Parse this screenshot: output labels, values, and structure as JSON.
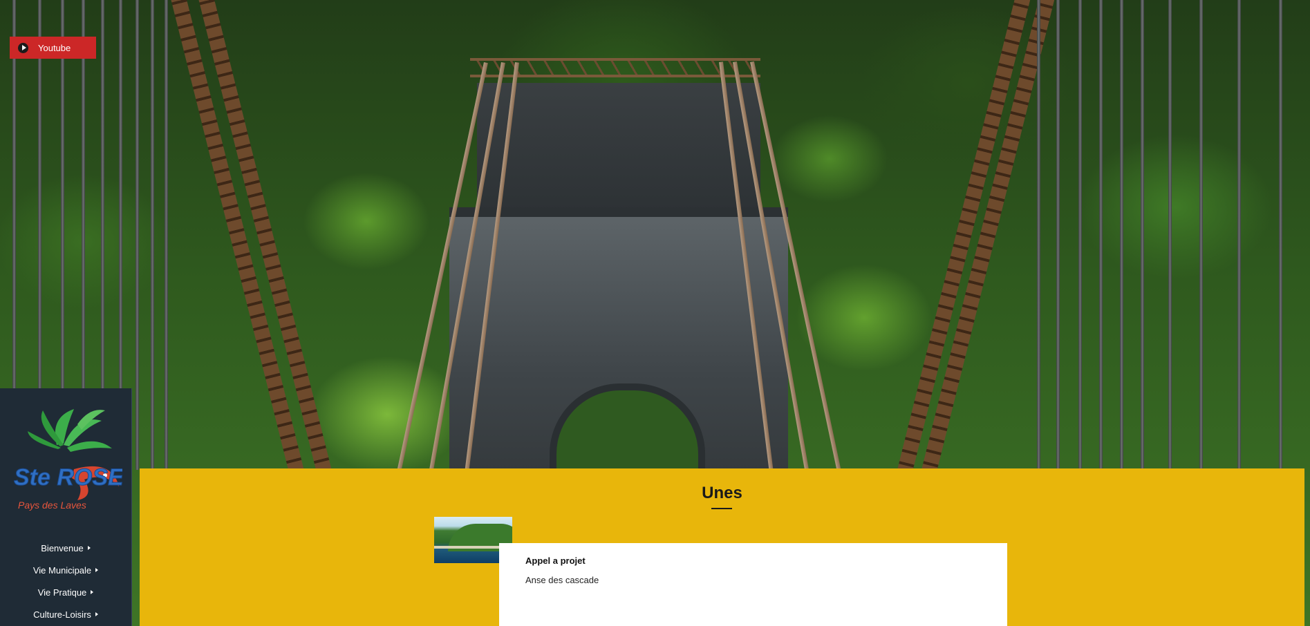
{
  "social": {
    "youtube_label": "Youtube"
  },
  "logo": {
    "wordmark": "Ste ROSE",
    "tagline": "Pays des Laves"
  },
  "nav": {
    "items": [
      {
        "label": "Bienvenue"
      },
      {
        "label": "Vie Municipale"
      },
      {
        "label": "Vie Pratique"
      },
      {
        "label": "Culture-Loisirs"
      }
    ]
  },
  "unes": {
    "title": "Unes",
    "card": {
      "title": "Appel a projet",
      "subtitle": "Anse des cascade"
    }
  },
  "colors": {
    "accent": "#e8b60b",
    "sidebar": "#1f2b36",
    "youtube": "#cc2727"
  }
}
